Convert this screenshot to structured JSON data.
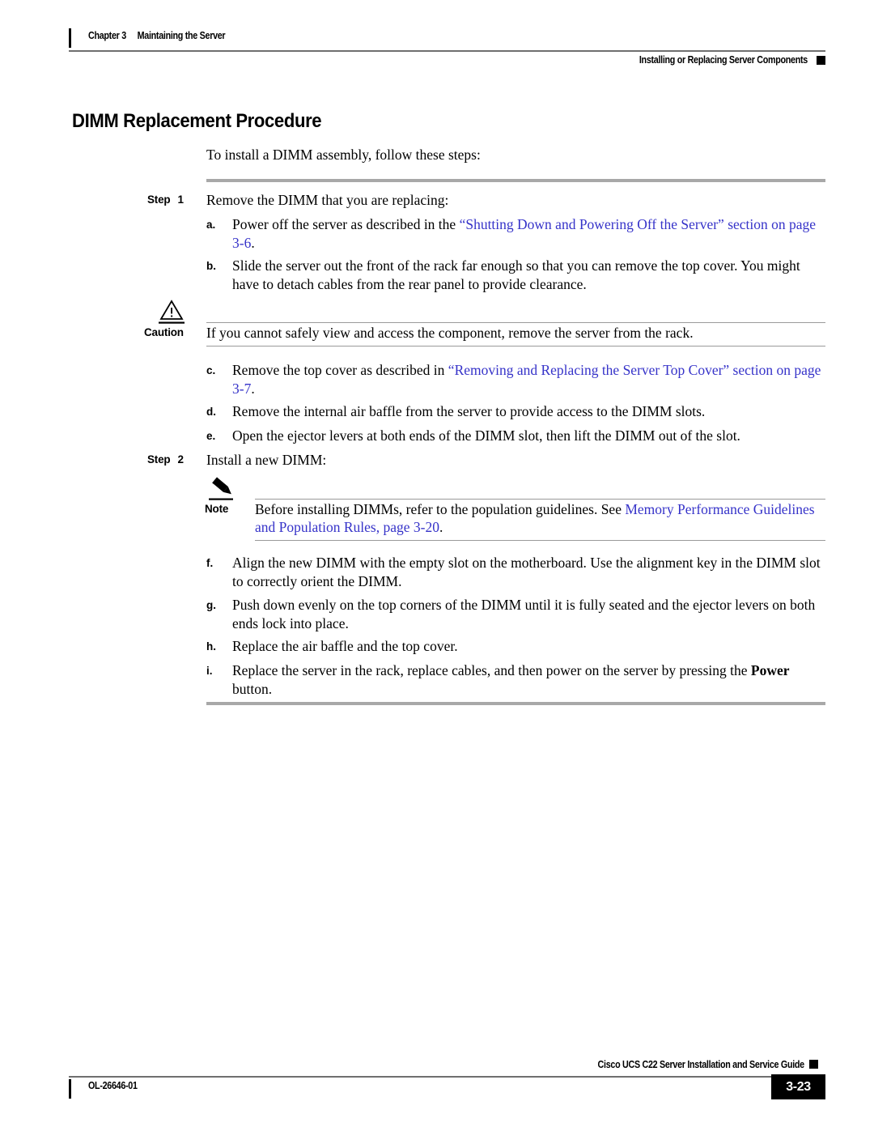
{
  "header": {
    "chapter_label": "Chapter 3",
    "chapter_title": "Maintaining the Server",
    "section_title": "Installing or Replacing Server Components"
  },
  "title": "DIMM Replacement Procedure",
  "intro": "To install a DIMM assembly, follow these steps:",
  "steps": [
    {
      "label": "Step",
      "number": "1",
      "text": "Remove the DIMM that you are replacing:"
    },
    {
      "label": "Step",
      "number": "2",
      "text": "Install a new DIMM:"
    }
  ],
  "items": {
    "a": {
      "marker": "a.",
      "text_before": "Power off the server as described in the ",
      "link": "“Shutting Down and Powering Off the Server” section on page 3-6",
      "text_after": "."
    },
    "b": {
      "marker": "b.",
      "text": "Slide the server out the front of the rack far enough so that you can remove the top cover. You might have to detach cables from the rear panel to provide clearance."
    },
    "c": {
      "marker": "c.",
      "text_before": "Remove the top cover as described in ",
      "link": "“Removing and Replacing the Server Top Cover” section on page 3-7",
      "text_after": "."
    },
    "d": {
      "marker": "d.",
      "text": "Remove the internal air baffle from the server to provide access to the DIMM slots."
    },
    "e": {
      "marker": "e.",
      "text": "Open the ejector levers at both ends of the DIMM slot, then lift the DIMM out of the slot."
    },
    "f": {
      "marker": "f.",
      "text": "Align the new DIMM with the empty slot on the motherboard. Use the alignment key in the DIMM slot to correctly orient the DIMM."
    },
    "g": {
      "marker": "g.",
      "text": "Push down evenly on the top corners of the DIMM until it is fully seated and the ejector levers on both ends lock into place."
    },
    "h": {
      "marker": "h.",
      "text": "Replace the air baffle and the top cover."
    },
    "i": {
      "marker": "i.",
      "text_before": "Replace the server in the rack, replace cables, and then power on the server by pressing the ",
      "emphasis": "Power",
      "text_after": " button."
    }
  },
  "caution": {
    "label": "Caution",
    "icon": "warning-triangle-icon",
    "text": "If you cannot safely view and access the component, remove the server from the rack."
  },
  "note": {
    "label": "Note",
    "icon": "pencil-icon",
    "text_before": "Before installing DIMMs, refer to the population guidelines. See ",
    "link": "Memory Performance Guidelines and Population Rules, page 3-20",
    "text_after": "."
  },
  "footer": {
    "guide_title": "Cisco UCS C22 Server Installation and Service Guide",
    "doc_number": "OL-26646-01",
    "page_number": "3-23"
  },
  "colors": {
    "link_blue": "#3633c9",
    "rule_grey": "#a8a8a8",
    "hairline_grey": "#9a9a9a",
    "black": "#000000"
  }
}
